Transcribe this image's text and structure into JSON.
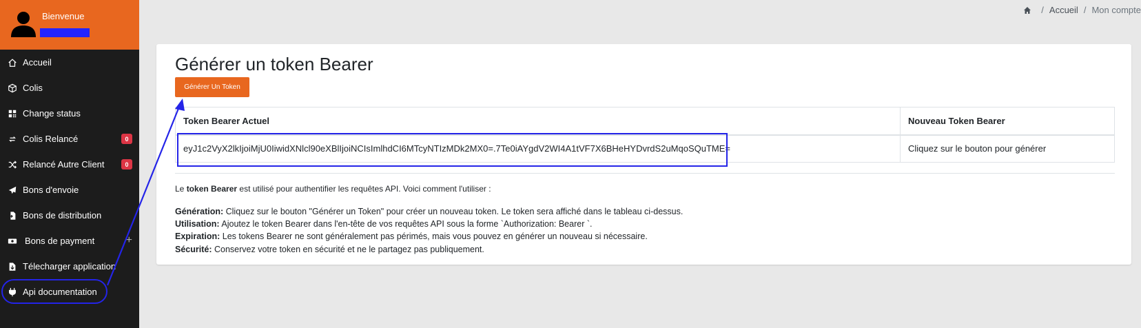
{
  "user": {
    "welcome": "Bienvenue"
  },
  "sidebar": {
    "items": [
      {
        "label": "Accueil",
        "icon": "home-icon"
      },
      {
        "label": "Colis",
        "icon": "box-icon"
      },
      {
        "label": "Change status",
        "icon": "qrcode-icon"
      },
      {
        "label": "Colis Relancé",
        "icon": "refresh-icon",
        "badge": "0"
      },
      {
        "label": "Relancé Autre Client",
        "icon": "shuffle-icon",
        "badge": "0"
      },
      {
        "label": "Bons d'envoie",
        "icon": "paper-plane-icon"
      },
      {
        "label": "Bons de distribution",
        "icon": "file-import-icon"
      },
      {
        "label": "Bons de payment",
        "icon": "money-icon",
        "extra": "+"
      },
      {
        "label": "Télecharger application",
        "icon": "file-download-icon"
      },
      {
        "label": "Api documentation",
        "icon": "plug-icon"
      }
    ]
  },
  "breadcrumb": {
    "items": [
      "Accueil",
      "Mon compte"
    ],
    "sep": "/"
  },
  "card": {
    "title": "Générer un token Bearer",
    "button_label": "Générer Un Token",
    "table": {
      "headers": [
        "Token Bearer Actuel",
        "Nouveau Token Bearer"
      ],
      "current_token": "eyJ1c2VyX2lkIjoiMjU0IiwidXNlcl90eXBlIjoiNCIsImlhdCI6MTcyNTIzMDk2MX0=.7Te0iAYgdV2WI4A1tVF7X6BHeHYDvrdS2uMqoSQuTME=",
      "new_token": "Cliquez sur le bouton pour générer"
    },
    "description": {
      "prefix": "Le ",
      "bold": "token Bearer",
      "suffix": " est utilisé pour authentifier les requêtes API. Voici comment l'utiliser :"
    },
    "info": [
      {
        "label": "Génération:",
        "text": " Cliquez sur le bouton \"Générer un Token\" pour créer un nouveau token. Le token sera affiché dans le tableau ci-dessus."
      },
      {
        "label": "Utilisation:",
        "text": " Ajoutez le token Bearer dans l'en-tête de vos requêtes API sous la forme `Authorization: Bearer `."
      },
      {
        "label": "Expiration:",
        "text": " Les tokens Bearer ne sont généralement pas périmés, mais vous pouvez en générer un nouveau si nécessaire."
      },
      {
        "label": "Sécurité:",
        "text": " Conservez votre token en sécurité et ne le partagez pas publiquement."
      }
    ]
  },
  "colors": {
    "accent": "#e8671f",
    "sidebar_bg": "#1c1c1c",
    "annotation": "#2424e8",
    "badge": "#dc3545"
  }
}
